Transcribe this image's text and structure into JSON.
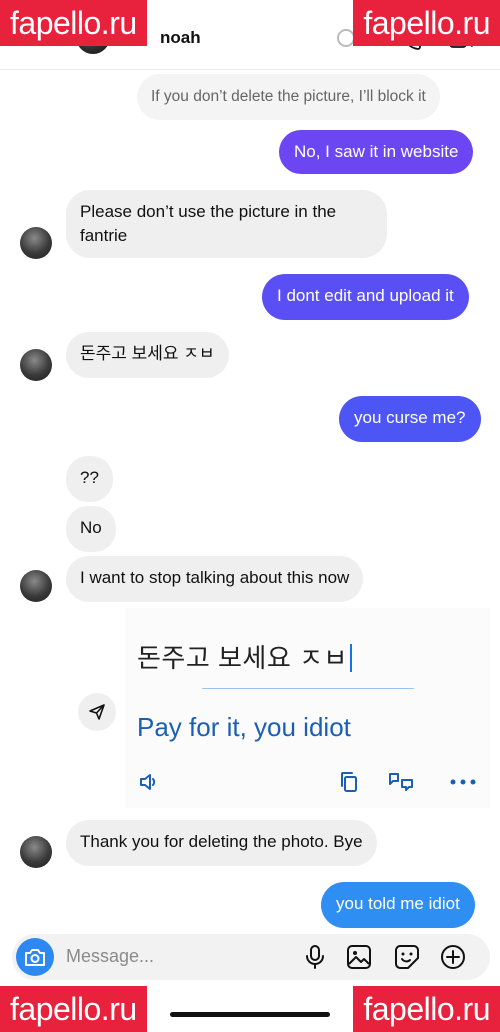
{
  "header": {
    "contact_name": "noah"
  },
  "watermark": {
    "text": "fapello.ru"
  },
  "messages": [
    {
      "text": "If you don’t delete the picture, I’ll block it",
      "from": "them"
    },
    {
      "text": "No, I saw it in website",
      "from": "me"
    },
    {
      "text": "Please don’t use the picture in the fantrie",
      "from": "them"
    },
    {
      "text": "I dont edit and upload it",
      "from": "me"
    },
    {
      "text": "돈주고 보세요 ㅈㅂ",
      "from": "them"
    },
    {
      "text": "you curse me?",
      "from": "me"
    },
    {
      "text": "??",
      "from": "them"
    },
    {
      "text": "No",
      "from": "them"
    },
    {
      "text": "I want to stop talking about this now",
      "from": "them"
    },
    {
      "text": "Thank you for deleting the photo. Bye",
      "from": "them"
    },
    {
      "text": "you told me idiot",
      "from": "me"
    }
  ],
  "translation": {
    "source": "돈주고 보세요 ㅈㅂ",
    "result": "Pay for it, you idiot"
  },
  "composer": {
    "placeholder": "Message..."
  },
  "colors": {
    "outgoing_top": "#7b3cf0",
    "outgoing_mid": "#5b4ff5",
    "outgoing_bottom": "#2f8ef2",
    "incoming": "#efefef",
    "translate_blue": "#1a5fb4",
    "watermark": "#e8223c"
  }
}
